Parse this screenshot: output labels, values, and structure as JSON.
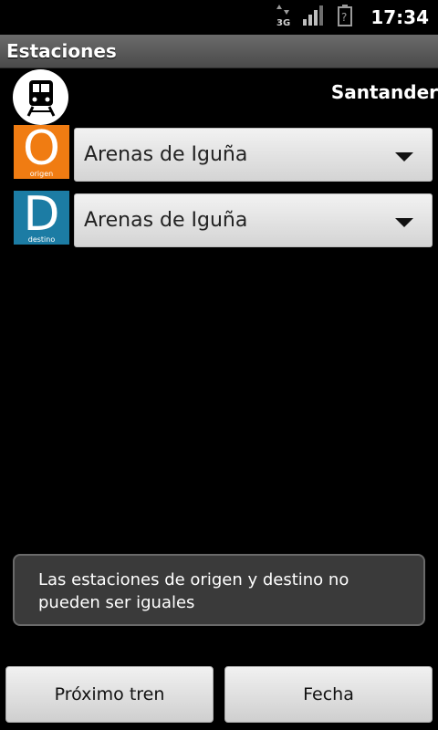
{
  "status_bar": {
    "time": "17:34",
    "network_label": "3G",
    "icons": [
      "data-arrows-icon",
      "signal-icon",
      "battery-unknown-icon"
    ]
  },
  "app": {
    "title": "Estaciones"
  },
  "header": {
    "city": "Santander",
    "logo_icon": "train-icon"
  },
  "origin": {
    "badge_letter": "O",
    "badge_sub": "origen",
    "badge_color": "#f07c12",
    "station": "Arenas de Iguña"
  },
  "destination": {
    "badge_letter": "D",
    "badge_sub": "destino",
    "badge_color": "#1c7ca4",
    "station": "Arenas de Iguña"
  },
  "toast": {
    "message": "Las estaciones de origen y destino no pueden ser iguales"
  },
  "buttons": {
    "next_train": "Próximo tren",
    "date": "Fecha"
  }
}
